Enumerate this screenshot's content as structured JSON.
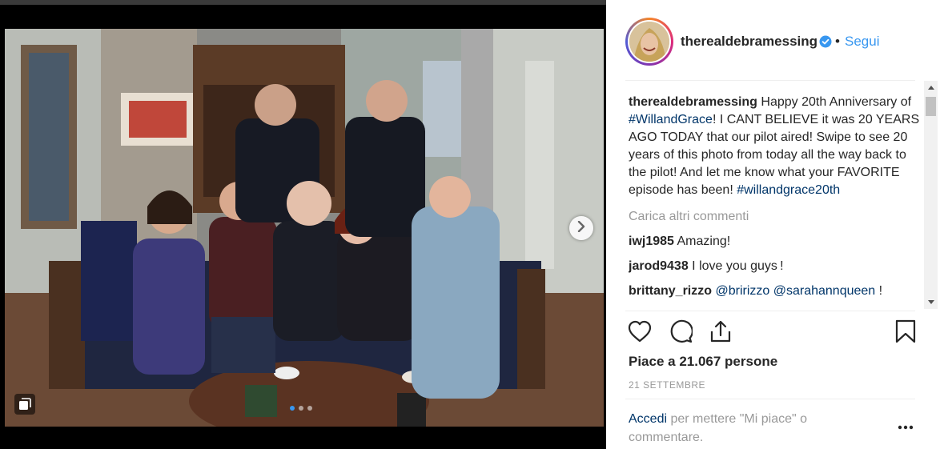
{
  "post": {
    "username": "therealdebramessing",
    "follow_label": "Segui",
    "separator": "•",
    "caption": {
      "user": "therealdebramessing",
      "text_1": "Happy 20th Anniversary of ",
      "hashtag_1": "#WillandGrace",
      "text_2": "! I CANT BELIEVE it was 20 YEARS AGO TODAY that our pilot aired! Swipe to see 20 years of this photo from today all the way back to the pilot! And let me know what your FAVORITE episode has been! ",
      "hashtag_2": "#willandgrace20th"
    },
    "load_more": "Carica altri commenti",
    "comments": [
      {
        "user": "iwj1985",
        "text": "Amazing!"
      },
      {
        "user": "jarod9438",
        "text": "I love you guys !"
      },
      {
        "user": "brittany_rizzo",
        "mention_1": "@bririzzo",
        "mention_2": "@sarahannqueen",
        "tail": " !"
      }
    ],
    "likes": "Piace a 21.067 persone",
    "date": "21 SETTEMBRE",
    "login": {
      "link": "Accedi",
      "text": " per mettere \"Mi piace\" o commentare."
    },
    "icons": {
      "like": "heart-icon",
      "comment": "comment-icon",
      "share": "share-icon",
      "save": "bookmark-icon",
      "verified": "verified-badge-icon",
      "next": "chevron-right-icon",
      "more": "more-options-icon",
      "carousel": "carousel-icon"
    },
    "carousel": {
      "slide_count": 3,
      "active_index": 0
    },
    "colors": {
      "link_blue": "#3897f0",
      "hashtag": "#003569",
      "muted": "#999999",
      "text": "#262626"
    }
  }
}
